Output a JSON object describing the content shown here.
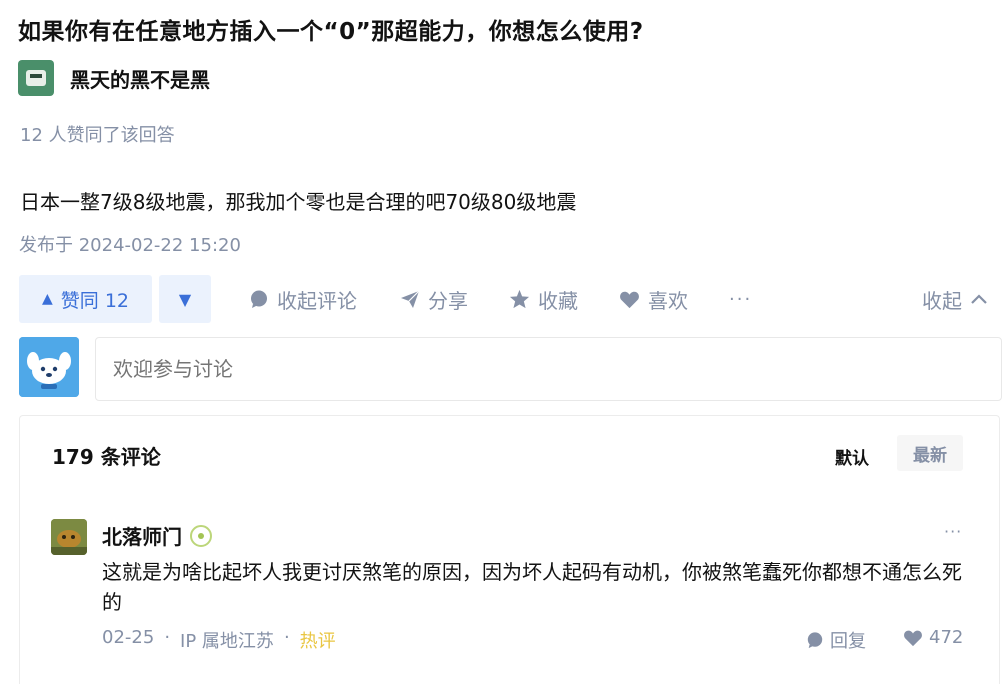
{
  "question": {
    "title": "如果你有在任意地方插入一个“0”那超能力，你想怎么使用?"
  },
  "author": {
    "name": "黑天的黑不是黑",
    "avatar_icon": "avatar-image"
  },
  "answer": {
    "votes_summary": "12 人赞同了该回答",
    "content": "日本一整7级8级地震，那我加个零也是合理的吧70级80级地震",
    "publish_time": "发布于 2024-02-22 15:20"
  },
  "actions": {
    "vote_up_arrow": "▲",
    "vote_up_label": "赞同 12",
    "vote_down_arrow": "▼",
    "comment_label": "收起评论",
    "share_label": "分享",
    "collect_label": "收藏",
    "like_label": "喜欢",
    "more_label": "···",
    "collapse_label": "收起",
    "accent_color": "#3a6fd8",
    "muted_color": "#8590a6"
  },
  "comment_input": {
    "placeholder": "欢迎参与讨论"
  },
  "comments": {
    "count_label": "179 条评论",
    "sort_default": "默认",
    "sort_new": "最新",
    "items": [
      {
        "name": "北落师门",
        "more": "···",
        "text": "这就是为啥比起坏人我更讨厌煞笔的原因，因为坏人起码有动机，你被煞笔蠢死你都想不通怎么死的",
        "date": "02-25",
        "location": "IP 属地江苏",
        "hot_label": "热评",
        "reply_label": "回复",
        "likes": "472"
      }
    ]
  }
}
